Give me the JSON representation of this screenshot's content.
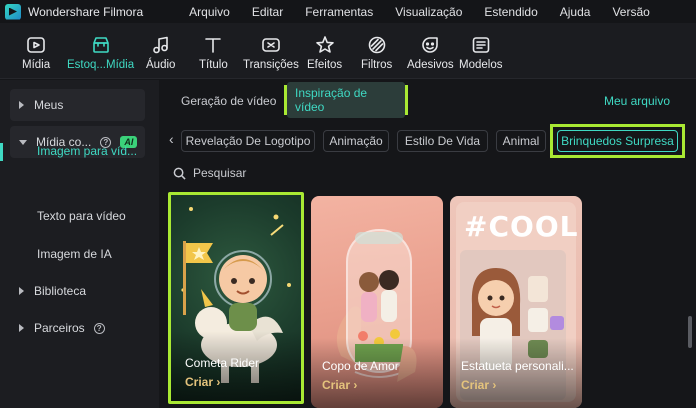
{
  "app": {
    "title": "Wondershare Filmora"
  },
  "menu": [
    "Arquivo",
    "Editar",
    "Ferramentas",
    "Visualização",
    "Estendido",
    "Ajuda",
    "Versão"
  ],
  "toolbar": [
    {
      "label": "Mídia",
      "icon": "media-icon"
    },
    {
      "label": "Estoq...Mídia",
      "icon": "stock-media-icon",
      "active": true
    },
    {
      "label": "Áudio",
      "icon": "music-note-icon"
    },
    {
      "label": "Título",
      "icon": "title-t-icon"
    },
    {
      "label": "Transições",
      "icon": "transition-icon"
    },
    {
      "label": "Efeitos",
      "icon": "effects-star-icon"
    },
    {
      "label": "Filtros",
      "icon": "filters-icon"
    },
    {
      "label": "Adesivos",
      "icon": "sticker-icon"
    },
    {
      "label": "Modelos",
      "icon": "templates-icon"
    }
  ],
  "sidebar": {
    "meus": "Meus",
    "midia_co": "Mídia co...",
    "ai_badge": "AI",
    "help": "?",
    "sub_items": [
      "Imagem para víd...",
      "Texto para vídeo",
      "Imagem de IA"
    ],
    "biblioteca": "Biblioteca",
    "parceiros": "Parceiros"
  },
  "main": {
    "tab_a": "Geração de vídeo",
    "tab_b": "Inspiração de vídeo",
    "my_file": "Meu arquivo",
    "chips": [
      "Revelação De Logotipo",
      "Animação",
      "Estilo De Vida",
      "Animal",
      "Brinquedos Surpresa"
    ],
    "search_placeholder": "Pesquisar",
    "create_label": "Criar",
    "cards": [
      {
        "title": "Cometa Rider"
      },
      {
        "title": "Copo de Amor"
      },
      {
        "title": "Estatueta personali..."
      }
    ],
    "card3_overlay": "#COOL"
  },
  "colors": {
    "accent": "#3fd9c3",
    "highlight": "#a9e933",
    "create": "#e4c37c"
  }
}
